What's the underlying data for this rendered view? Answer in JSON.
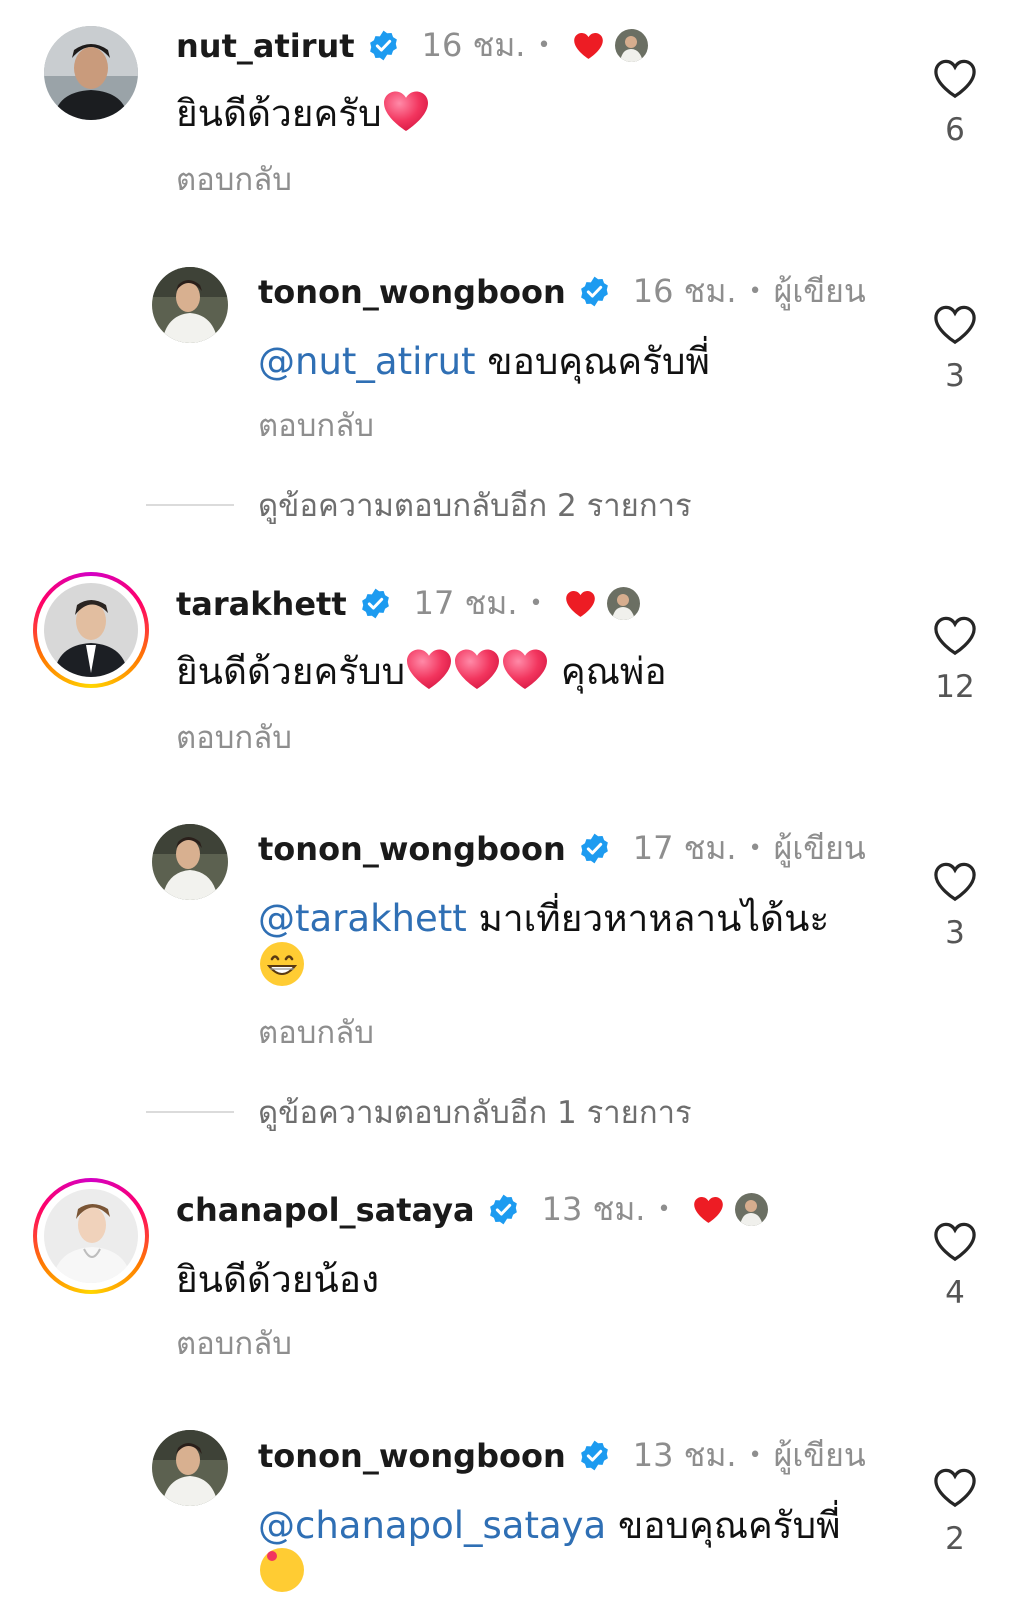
{
  "comments": [
    {
      "username": "nut_atirut",
      "time": "16 ชม.",
      "text": "ยินดีด้วยครับ",
      "reply_label": "ตอบกลับ",
      "likes": "6"
    },
    {
      "username": "tonon_wongboon",
      "time": "16 ชม.",
      "author_label": "ผู้เขียน",
      "mention": "@nut_atirut",
      "text": " ขอบคุณครับพี่",
      "reply_label": "ตอบกลับ",
      "likes": "3"
    },
    {
      "view_more": "ดูข้อความตอบกลับอีก 2 รายการ"
    },
    {
      "username": "tarakhett",
      "time": "17 ชม.",
      "text": "ยินดีด้วยครับบ",
      "text_suffix": " คุณพ่อ",
      "reply_label": "ตอบกลับ",
      "likes": "12"
    },
    {
      "username": "tonon_wongboon",
      "time": "17 ชม.",
      "author_label": "ผู้เขียน",
      "mention": "@tarakhett",
      "text": " มาเที่ยวหาหลานได้นะ",
      "reply_label": "ตอบกลับ",
      "likes": "3"
    },
    {
      "view_more": "ดูข้อความตอบกลับอีก 1 รายการ"
    },
    {
      "username": "chanapol_sataya",
      "time": "13 ชม.",
      "text": "ยินดีด้วยน้อง",
      "reply_label": "ตอบกลับ",
      "likes": "4"
    },
    {
      "username": "tonon_wongboon",
      "time": "13 ชม.",
      "author_label": "ผู้เขียน",
      "mention": "@chanapol_sataya",
      "text": "  ขอบคุณครับพี่",
      "likes": "2"
    }
  ],
  "colors": {
    "mention": "#2f6fb4",
    "verified": "#1d9bf0",
    "liked_heart": "#ed1c24",
    "muted": "#8e8e8e"
  }
}
